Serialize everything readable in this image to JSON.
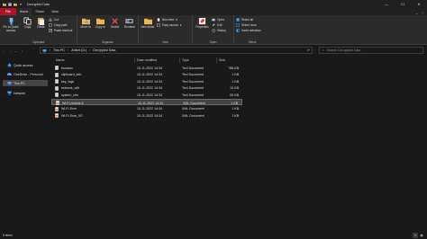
{
  "window": {
    "title": "Decrypted Data",
    "controls": {
      "minimize": "—",
      "maximize": "☐",
      "close": "✕"
    }
  },
  "ribbon_tabs": {
    "file": "File",
    "home": "Home",
    "share": "Share",
    "view": "View"
  },
  "ribbon": {
    "clipboard": {
      "label": "Clipboard",
      "pin": "Pin to Quick access",
      "copy": "Copy",
      "paste": "Paste",
      "cut": "Cut",
      "copy_path": "Copy path",
      "paste_shortcut": "Paste shortcut"
    },
    "organize": {
      "label": "Organize",
      "move_to": "Move to",
      "copy_to": "Copy to",
      "delete": "Delete",
      "rename": "Rename"
    },
    "new": {
      "label": "New",
      "new_folder": "New folder",
      "new_item": "New item",
      "easy_access": "Easy access"
    },
    "open": {
      "label": "Open",
      "properties": "Properties",
      "open": "Open",
      "edit": "Edit",
      "history": "History"
    },
    "select": {
      "label": "Select",
      "select_all": "Select all",
      "select_none": "Select none",
      "invert_selection": "Invert selection"
    }
  },
  "address": {
    "crumbs": [
      "This PC",
      "Aniket (D:)",
      "Decrypted Data"
    ],
    "search_placeholder": "Search Decrypted Data"
  },
  "nav": {
    "quick_access": "Quick access",
    "onedrive": "OneDrive - Personal",
    "this_pc": "This PC",
    "network": "Network"
  },
  "columns": {
    "name": "Name",
    "date": "Date modified",
    "type": "Type",
    "size": "Size"
  },
  "files": [
    {
      "name": "browser",
      "date": "10-11-2022 14:34",
      "type": "Text Document",
      "size": "786 KB",
      "kind": "txt"
    },
    {
      "name": "clipboard_info",
      "date": "10-11-2022 14:34",
      "type": "Text Document",
      "size": "1 KB",
      "kind": "txt"
    },
    {
      "name": "key_logs",
      "date": "10-11-2022 14:34",
      "type": "Text Document",
      "size": "1 KB",
      "kind": "txt"
    },
    {
      "name": "network_wifi",
      "date": "10-11-2022 14:34",
      "type": "Text Document",
      "size": "10 KB",
      "kind": "txt"
    },
    {
      "name": "system_info",
      "date": "10-11-2022 14:34",
      "type": "Text Document",
      "size": "50 KB",
      "kind": "txt"
    },
    {
      "name": "Wi-Fi-realme 6",
      "date": "10-11-2022 14:34",
      "type": "XML Document",
      "size": "1 KB",
      "kind": "xml"
    },
    {
      "name": "Wi-Fi-Som",
      "date": "10-11-2022 14:34",
      "type": "XML Document",
      "size": "1 KB",
      "kind": "xml"
    },
    {
      "name": "Wi-Fi-Som_5G",
      "date": "10-11-2022 14:34",
      "type": "XML Document",
      "size": "1 KB",
      "kind": "xml"
    }
  ],
  "status": {
    "items": "8 items"
  },
  "colors": {
    "accent": "#b4122b",
    "folder": "#e8b84a",
    "selection": "#434343"
  }
}
